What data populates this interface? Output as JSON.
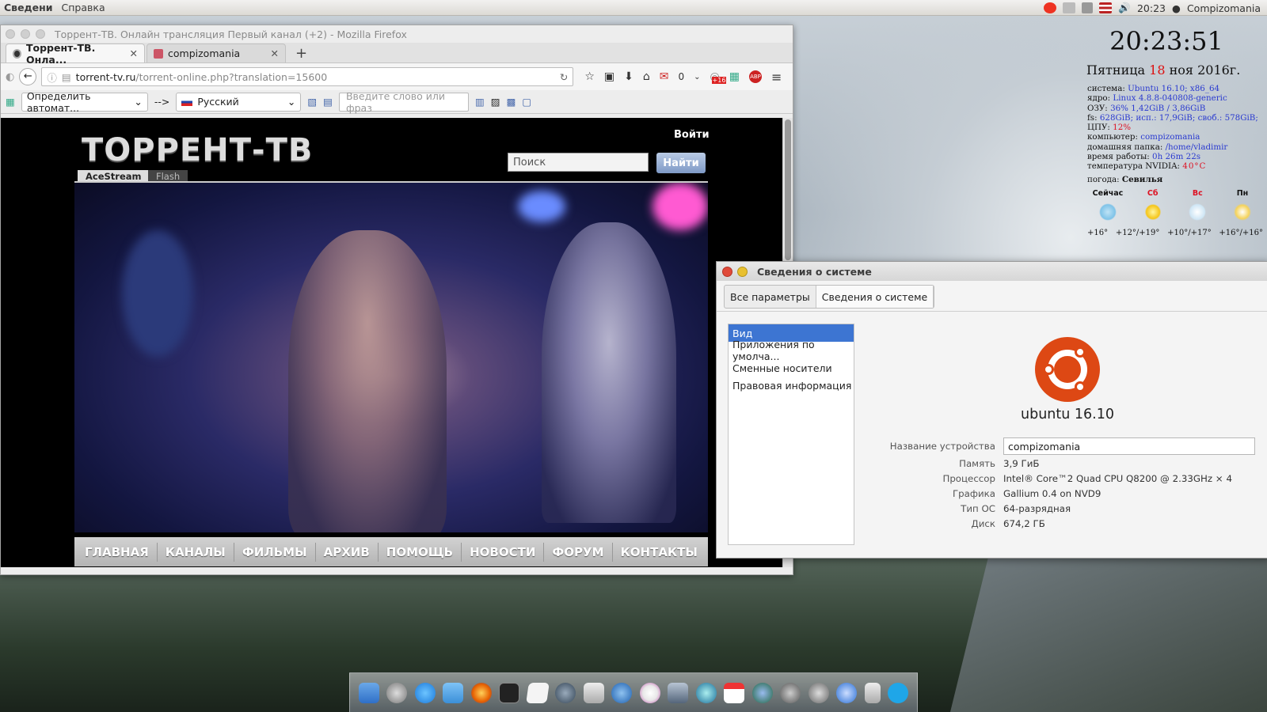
{
  "top_panel": {
    "menu_app": "Сведени",
    "menu_help": "Справка",
    "time": "20:23",
    "user": "Compizomania"
  },
  "firefox": {
    "title": "Торрент-ТВ. Онлайн трансляция Первый канал (+2) - Mozilla Firefox",
    "tabs": [
      {
        "label": "Торрент-ТВ. Онла...",
        "active": true
      },
      {
        "label": "compizomania",
        "active": false
      }
    ],
    "url_host": "torrent-tv.ru",
    "url_path": "/torrent-online.php?translation=15600",
    "mail_count": "0",
    "badge": "+16",
    "translate": {
      "source": "Определить автомат...",
      "arrow": "-->",
      "target": "Русский",
      "placeholder": "Введите слово или фраз"
    },
    "page": {
      "logo": "ТОРРЕНТ-ТВ",
      "login": "Войти",
      "search_placeholder": "Поиск",
      "search_button": "Найти",
      "subtabs": [
        "AceStream",
        "Flash"
      ],
      "nav": [
        "ГЛАВНАЯ",
        "КАНАЛЫ",
        "ФИЛЬМЫ",
        "АРХИВ",
        "ПОМОЩЬ",
        "НОВОСТИ",
        "ФОРУМ",
        "КОНТАКТЫ"
      ]
    }
  },
  "conky": {
    "clock": "20:23:51",
    "date_day": "Пятница",
    "date_num": "18",
    "date_rest": "ноя 2016г.",
    "lines": [
      {
        "k": "система:",
        "v": "Ubuntu 16.10; x86_64"
      },
      {
        "k": "ядро:",
        "v": "Linux 4.8.8-040808-generic"
      },
      {
        "k": "ОЗУ:",
        "v": "36% 1,42GiB / 3,86GiB"
      },
      {
        "k": "fs:",
        "v": "628GiB; исп.: 17,9GiB; своб.: 578GiB;"
      },
      {
        "k": "ЦПУ:",
        "v": "12%"
      },
      {
        "k": "компьютер:",
        "v": "compizomania"
      },
      {
        "k": "домашняя папка:",
        "v": "/home/vladimir"
      },
      {
        "k": "время работы:",
        "v": "0h 26m 22s"
      },
      {
        "k": "температура NVIDIA:",
        "v": "40°C"
      }
    ],
    "weather_label": "погода:",
    "weather_city": "Севилья",
    "forecast": [
      {
        "day": "Сейчас",
        "temp": "+16°"
      },
      {
        "day": "Сб",
        "temp": "+12°/+19°"
      },
      {
        "day": "Вс",
        "temp": "+10°/+17°"
      },
      {
        "day": "Пн",
        "temp": "+16°/+16°"
      }
    ]
  },
  "sysinfo": {
    "title": "Сведения о системе",
    "breadcrumb": [
      "Все параметры",
      "Сведения о системе"
    ],
    "sidebar": [
      "Вид",
      "Приложения по умолча...",
      "Сменные носители",
      "Правовая информация"
    ],
    "os_name": "ubuntu 16.10",
    "rows": [
      {
        "k": "Название устройства",
        "v": "compizomania"
      },
      {
        "k": "Память",
        "v": "3,9 ГиБ"
      },
      {
        "k": "Процессор",
        "v": "Intel® Core™2 Quad CPU Q8200 @ 2.33GHz × 4"
      },
      {
        "k": "Графика",
        "v": "Gallium 0.4 on NVD9"
      },
      {
        "k": "Тип ОС",
        "v": "64-разрядная"
      },
      {
        "k": "Диск",
        "v": "674,2 ГБ"
      }
    ]
  },
  "dock_icons": [
    "finder-icon",
    "launchpad-icon",
    "appstore-icon",
    "files-icon",
    "firefox-icon",
    "terminal-icon",
    "text-editor-icon",
    "steam-icon",
    "mail-icon",
    "thunderbird-icon",
    "music-icon",
    "photos-icon",
    "search-icon",
    "calendar-icon",
    "timemachine-icon",
    "settings-icon",
    "xcode-icon",
    "updater-icon",
    "trash-icon",
    "skype-icon"
  ]
}
